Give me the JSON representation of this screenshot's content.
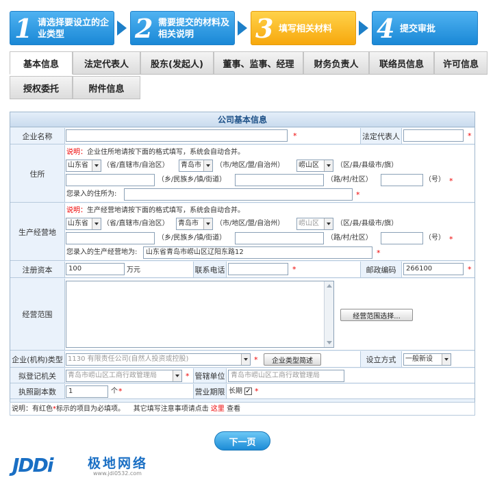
{
  "steps": [
    {
      "num": "1",
      "label": "请选择要设立的企业类型"
    },
    {
      "num": "2",
      "label": "需要提交的材料及相关说明"
    },
    {
      "num": "3",
      "label": "填写相关材料"
    },
    {
      "num": "4",
      "label": "提交审批"
    }
  ],
  "tabs_row1": [
    "基本信息",
    "法定代表人",
    "股东(发起人)",
    "董事、监事、经理",
    "财务负责人",
    "联络员信息",
    "许可信息"
  ],
  "tabs_row2": [
    "授权委托",
    "附件信息"
  ],
  "form": {
    "title": "公司基本信息",
    "company_name_label": "企业名称",
    "legal_rep_label": "法定代表人",
    "address_label": "住所",
    "address_note_prefix": "说明：",
    "address_note": "企业住所地请按下面的格式填写，系统会自动合并。",
    "province": "山东省",
    "province_suffix": "（省/直辖市/自治区）",
    "city": "青岛市",
    "city_suffix": "（市/地区/盟/自治州）",
    "district": "崂山区",
    "district_suffix": "（区/县/县级市/旗）",
    "town_suffix": "（乡/民族乡/镇/街道）",
    "road_suffix": "（路/村/社区）",
    "number_suffix": "（号）",
    "address_entered_label": "您录入的住所为:",
    "prod_label": "生产经营地",
    "prod_note_prefix": "说明：",
    "prod_note": "生产经营地请按下面的格式填写，系统会自动合并。",
    "prod_province": "山东省",
    "prod_city": "青岛市",
    "prod_district": "崂山区",
    "prod_entered_label": "您录入的生产经营地为:",
    "prod_entered_value": "山东省青岛市崂山区辽阳东路12",
    "capital_label": "注册资本",
    "capital_value": "100",
    "capital_unit": "万元",
    "phone_label": "联系电话",
    "postcode_label": "邮政编码",
    "postcode_value": "266100",
    "scope_label": "经营范围",
    "scope_button": "经营范围选择...",
    "type_label": "企业(机构)类型",
    "type_value": "1130 有限责任公司(自然人投资或控股)",
    "type_desc_button": "企业类型简述",
    "setup_label": "设立方式",
    "setup_value": "一般新设",
    "reg_authority_label": "拟登记机关",
    "reg_authority_value": "青岛市崂山区工商行政管理局",
    "jurisdiction_label": "管辖单位",
    "jurisdiction_value": "青岛市崂山区工商行政管理局",
    "copies_label": "执照副本数",
    "copies_value": "1",
    "copies_unit": "个",
    "term_label": "营业期限",
    "term_value": "长期",
    "term_checked": "✓",
    "footer_note_a": "说明：有红色",
    "footer_note_b": "标示的项目为必填项。",
    "footer_note_c": "其它填写注意事项请点击",
    "footer_link": "这里",
    "footer_note_d": "查看",
    "star": "*"
  },
  "next_button": "下一页",
  "logo": {
    "mark": "JDDi",
    "cn": "极地网络",
    "url": "www.jdi0532.com"
  },
  "colors": {
    "step_blue": "#1a88d6",
    "step_active": "#f7a80d",
    "form_bg": "#eaf2fb",
    "required": "#e00000"
  }
}
